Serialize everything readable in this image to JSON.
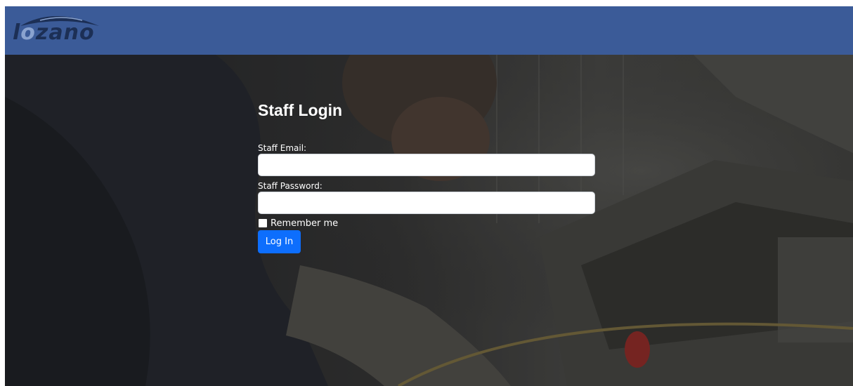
{
  "header": {
    "logo_text_dark": "l",
    "logo_text_light": "o",
    "logo_text_rest": "zano",
    "brand_color": "#3b5b98"
  },
  "login": {
    "title": "Staff Login",
    "email_label": "Staff Email:",
    "email_value": "",
    "password_label": "Staff Password:",
    "password_value": "",
    "remember_label": "Remember me",
    "remember_checked": false,
    "submit_label": "Log In",
    "button_color": "#0d6efd"
  },
  "background": {
    "image_subject": "mechanic-working-on-car-engine-photo"
  }
}
